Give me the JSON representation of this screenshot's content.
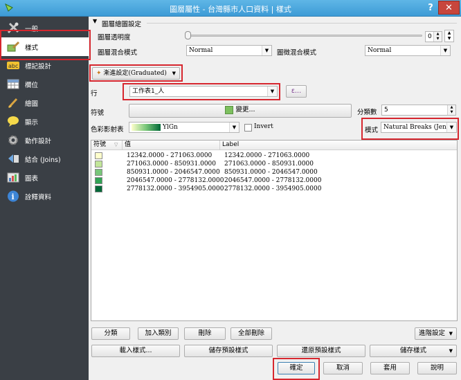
{
  "window": {
    "title": "圖層屬性 - 台灣縣市人口資料 | 樣式",
    "help": "?",
    "close": "✕"
  },
  "sidebar": {
    "items": [
      {
        "label": "一般",
        "icon": "tools-icon"
      },
      {
        "label": "樣式",
        "icon": "style-brush-icon"
      },
      {
        "label": "標記設計",
        "icon": "abc-label-icon"
      },
      {
        "label": "欄位",
        "icon": "table-fields-icon"
      },
      {
        "label": "繪圖",
        "icon": "paint-brush-icon"
      },
      {
        "label": "顯示",
        "icon": "speech-bubble-icon"
      },
      {
        "label": "動作設計",
        "icon": "gear-icon"
      },
      {
        "label": "結合 (Joins)",
        "icon": "join-icon"
      },
      {
        "label": "圖表",
        "icon": "diagram-icon"
      },
      {
        "label": "詮釋資料",
        "icon": "info-icon"
      }
    ]
  },
  "rendering": {
    "group_title": "圖層繪圖設定",
    "transparency_label": "圖層透明度",
    "transparency_value": "0",
    "layer_blend_label": "圖層混合模式",
    "layer_blend_value": "Normal",
    "feature_blend_label": "圖徵混合模式",
    "feature_blend_value": "Normal"
  },
  "renderer": {
    "type": "漸進設定(Graduated)"
  },
  "column": {
    "label": "行",
    "value": "工作表1_人",
    "expr_button": "ε..."
  },
  "symbol": {
    "label": "符號",
    "button": "變更...",
    "swatch_color": "#7dc05f"
  },
  "classes": {
    "label": "分類數",
    "value": "5"
  },
  "color_ramp": {
    "label": "色彩影射表",
    "value": "YlGn",
    "invert_label": "Invert"
  },
  "mode": {
    "label": "模式",
    "value": "Natural Breaks (Jenks)"
  },
  "table": {
    "headers": [
      "符號",
      "值",
      "Label"
    ],
    "rows": [
      {
        "color": "#ffffcc",
        "value": "12342.0000 - 271063.0000",
        "label": "12342.0000 - 271063.0000"
      },
      {
        "color": "#c2e699",
        "value": "271063.0000 - 850931.0000",
        "label": "271063.0000 - 850931.0000"
      },
      {
        "color": "#78c679",
        "value": "850931.0000 - 2046547.0000",
        "label": "850931.0000 - 2046547.0000"
      },
      {
        "color": "#31a354",
        "value": "2046547.0000 - 2778132.0000",
        "label": "2046547.0000 - 2778132.0000"
      },
      {
        "color": "#006837",
        "value": "2778132.0000 - 3954905.0000",
        "label": "2778132.0000 - 3954905.0000"
      }
    ]
  },
  "table_buttons": {
    "classify": "分類",
    "add": "加入類別",
    "delete": "刪除",
    "delete_all": "全部刪除",
    "advanced": "進階設定"
  },
  "style_buttons": {
    "load": "載入樣式...",
    "save_default": "儲存預設樣式",
    "restore_default": "還原預設樣式",
    "save_style": "儲存樣式"
  },
  "dialog_buttons": {
    "ok": "確定",
    "cancel": "取消",
    "apply": "套用",
    "help": "說明"
  },
  "colors": {
    "highlight_red": "#d6262e",
    "sidebar_bg": "#3a3f45"
  }
}
